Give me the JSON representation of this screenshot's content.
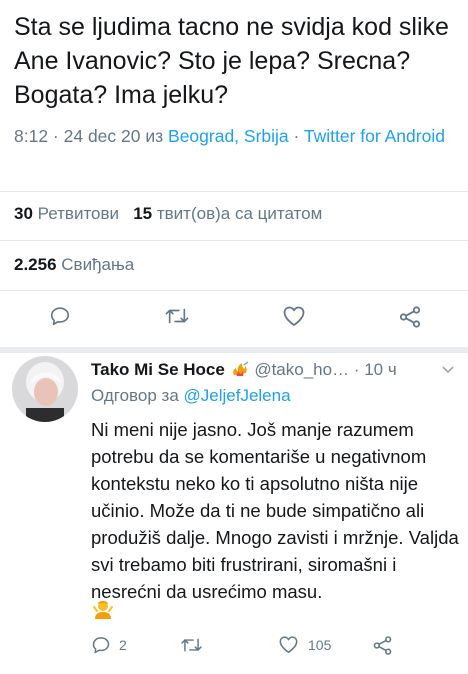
{
  "tweet": {
    "text": "Sta  se ljudima tacno ne svidja kod slike Ane Ivanovic? Sto je lepa? Srecna? Bogata? Ima jelku?",
    "time_date": "8:12 · 24 dec 20 из ",
    "location": "Beograd, Srbija",
    "separator": " · ",
    "source": "Twitter for Android"
  },
  "stats": {
    "retweets_count": "30",
    "retweets_label": "Ретвитови",
    "quotes_count": "15",
    "quotes_label": "твит(ов)а са цитатом",
    "likes_count": "2.256",
    "likes_label": "Свиђања"
  },
  "actions": [
    "reply-icon",
    "retweet-icon",
    "like-icon",
    "share-icon"
  ],
  "reply": {
    "name": "Tako Mi Se Hoce",
    "handle": "@tako_ho…",
    "time": "· 10 ч",
    "replying_prefix": "Одговор за ",
    "replying_to": "@JeljefJelena",
    "text": "Ni meni nije jasno. Još manje razumem potrebu da se komentariše u negativnom kontekstu neko ko ti apsolutno ništa nije učinio. Može da ti ne bude simpatično ali produžiš dalje. Mnogo zavisti i mržnje. Valjda svi trebamo biti frustrirani, siromašni i nesrećni da usrećimo masu.",
    "reply_count": "2",
    "like_count": "105"
  },
  "colors": {
    "link": "#1da1f2",
    "muted": "#657786",
    "text": "#14171a",
    "divider": "#e1e8ed"
  }
}
